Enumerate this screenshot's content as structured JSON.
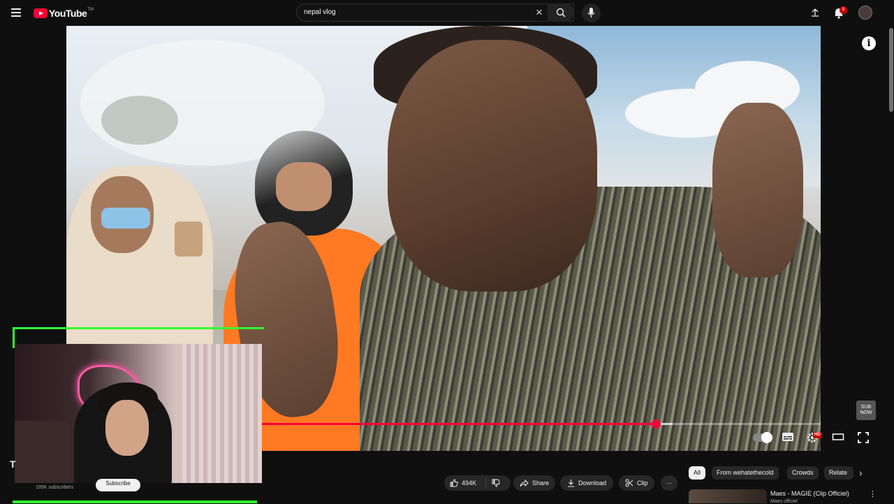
{
  "header": {
    "logo_text": "YouTube",
    "logo_tm": "TM",
    "search_value": "nepal vlog",
    "notification_count": "8"
  },
  "player": {
    "progress_fraction": 0.705,
    "buffer_fraction": 0.03,
    "hd_label": "HD",
    "sub_now_label": "SUB NOW",
    "info_label": "i"
  },
  "channel": {
    "title_stub": "T",
    "subscribers": "195K subscribers",
    "subscribe_label": "Subscribe"
  },
  "actions": {
    "likes": "494K",
    "share": "Share",
    "download": "Download",
    "clip": "Clip",
    "more": "···"
  },
  "chips": [
    "All",
    "From wehatethecold",
    "Crowds",
    "Relate"
  ],
  "recommendation": {
    "title": "Maes - MAGIE (Clip Officiel)",
    "channel": "Maes officiel"
  },
  "colors": {
    "accent": "#ff0033",
    "neon": "#31ff31",
    "bg": "#0f0f0f"
  }
}
